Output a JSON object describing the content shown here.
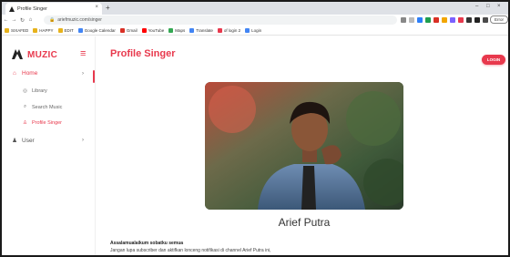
{
  "browser": {
    "tab_title": "Profile Singer",
    "tab_close": "×",
    "new_tab": "+",
    "url": "ariefmuzic.com/singer",
    "profile_chip": "Error",
    "window_controls": [
      "–",
      "□",
      "×"
    ],
    "bookmarks": [
      {
        "label": "SIXAFED",
        "color": "#e7b21b"
      },
      {
        "label": "HAPPY",
        "color": "#e7b21b"
      },
      {
        "label": "EDIT",
        "color": "#e7b21b"
      },
      {
        "label": "Google Calendar",
        "color": "#4285f4"
      },
      {
        "label": "Gmail",
        "color": "#d93025"
      },
      {
        "label": "YouTube",
        "color": "#ff0000"
      },
      {
        "label": "Maps",
        "color": "#34a853"
      },
      {
        "label": "Translate",
        "color": "#4285f4"
      },
      {
        "label": "of login 2",
        "color": "#e8394d"
      },
      {
        "label": "Login",
        "color": "#4285f4"
      }
    ],
    "extensions": [
      "#888888",
      "#bbbbbb",
      "#2d7ff9",
      "#1f9e4f",
      "#d93025",
      "#f2a600",
      "#7b61ff",
      "#e8394d",
      "#333333",
      "#222222",
      "#4a4a4a",
      "#555555",
      "#ff5a1f"
    ]
  },
  "sidebar": {
    "brand": "MUZIC",
    "items": [
      {
        "label": "Home",
        "icon": "home-icon",
        "active": true,
        "has_chevron": true
      },
      {
        "label": "User",
        "icon": "user-icon",
        "active": false,
        "has_chevron": true
      }
    ],
    "sub_items": [
      {
        "label": "Library",
        "icon": "disc-icon",
        "active": false
      },
      {
        "label": "Search Music",
        "icon": "search-icon",
        "active": false
      },
      {
        "label": "Profile Singer",
        "icon": "person-icon",
        "active": true
      }
    ]
  },
  "main": {
    "title": "Profile Singer",
    "login_label": "LOGIN",
    "singer_name": "Arief Putra",
    "greeting": "Assalamualaikum sobatku semua",
    "description": "Jangan lupa subscriber dan aktifkan lonceng notifikasi di channel Arief Putra ini,"
  },
  "colors": {
    "accent": "#e8394d",
    "sidebar_bg": "#ffffff",
    "text": "#333333"
  }
}
